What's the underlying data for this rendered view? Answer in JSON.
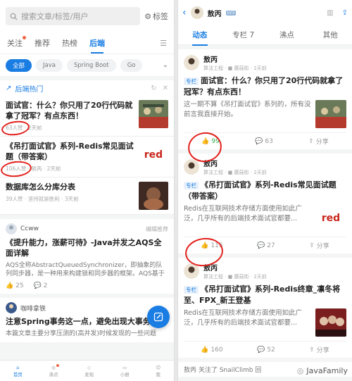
{
  "left": {
    "search": {
      "placeholder": "搜索文章/标签/用户"
    },
    "tag_button": "标签",
    "tabs": [
      {
        "label": "关注",
        "dot": true
      },
      {
        "label": "推荐"
      },
      {
        "label": "热榜"
      },
      {
        "label": "后端",
        "active": true
      }
    ],
    "chips": [
      "全部",
      "Java",
      "Spring Boot",
      "Go"
    ],
    "hot": {
      "title": "后端热门"
    },
    "hot_items": [
      {
        "title": "面试官：什么？你只用了20行代码就拿了冠军？有点东西！",
        "meta": "63人赞 · 2天前"
      },
      {
        "title": "《吊打面试官》系列-Redis常见面试题（带答案）",
        "meta": "106人赞 · 敖丙 · 2天前",
        "thumb_text": "red"
      },
      {
        "title": "数据库怎么分库分表",
        "meta": "39人赞 · 坚持就是胜利 · 3天前"
      }
    ],
    "feed": [
      {
        "author": "Ccww",
        "badge": "编辑推荐",
        "title": "《提升能力，涨薪可待》-Java并发之AQS全面详解",
        "desc": "AQS全称AbstractQueuedSynchronizer，即抽象的队列同步器，是一种用来构建锁和同步器的框架。AQS基于",
        "likes": "25",
        "comments": "2"
      },
      {
        "author": "咖啡拿铁",
        "title": "注意Spring事务这一点，避免出现大事务",
        "desc": "本篇文章主要分享压测的(高并发)时候发现的一些问题"
      }
    ],
    "nav": [
      "首页",
      "沸点",
      "发现",
      "小册",
      "我"
    ]
  },
  "right": {
    "header": {
      "name": "敖丙",
      "level": "LV3"
    },
    "tabs": [
      "动态",
      "专栏 7",
      "沸点",
      "其他"
    ],
    "cards": [
      {
        "name": "敖丙",
        "sub": "算法工程 · ■ 蘑菇街 · 2天前",
        "tag": "专栏",
        "title": "面试官：什么？你只用了20行代码就拿了冠军？有点东西！",
        "desc": "这一期不算《吊打面试官》系列的，所有没前言我直接开始。",
        "likes": "99",
        "comments": "63",
        "share": "分享"
      },
      {
        "name": "敖丙",
        "sub": "算法工程 · ■ 蘑菇街 · 2天前",
        "tag": "专栏",
        "title": "《吊打面试官》系列-Redis常见面试题（带答案）",
        "desc": "Redis在互联网技术存储方面使用如此广泛，几乎所有的后端技术面试官都要...",
        "thumb_text": "red",
        "likes": "115",
        "comments": "27",
        "share": "分享"
      },
      {
        "name": "敖丙",
        "sub": "算法工程 · ■ 蘑菇街 · 2天前",
        "tag": "专栏",
        "title": "《吊打面试官》系列-Redis终章_凛冬将至、FPX_新王登基",
        "desc": "Redis在互联网技术存储方面使用如此广泛，几乎所有的后端技术面试官都要...",
        "likes": "160",
        "comments": "52",
        "share": "分享"
      }
    ],
    "footer_partial": "敖丙 关注了 SnailClimb 回"
  },
  "watermark": "JavaFamily",
  "colors": {
    "accent": "#1a7de3",
    "like_green": "#2eaa4f",
    "highlight_red": "#e2211c"
  }
}
